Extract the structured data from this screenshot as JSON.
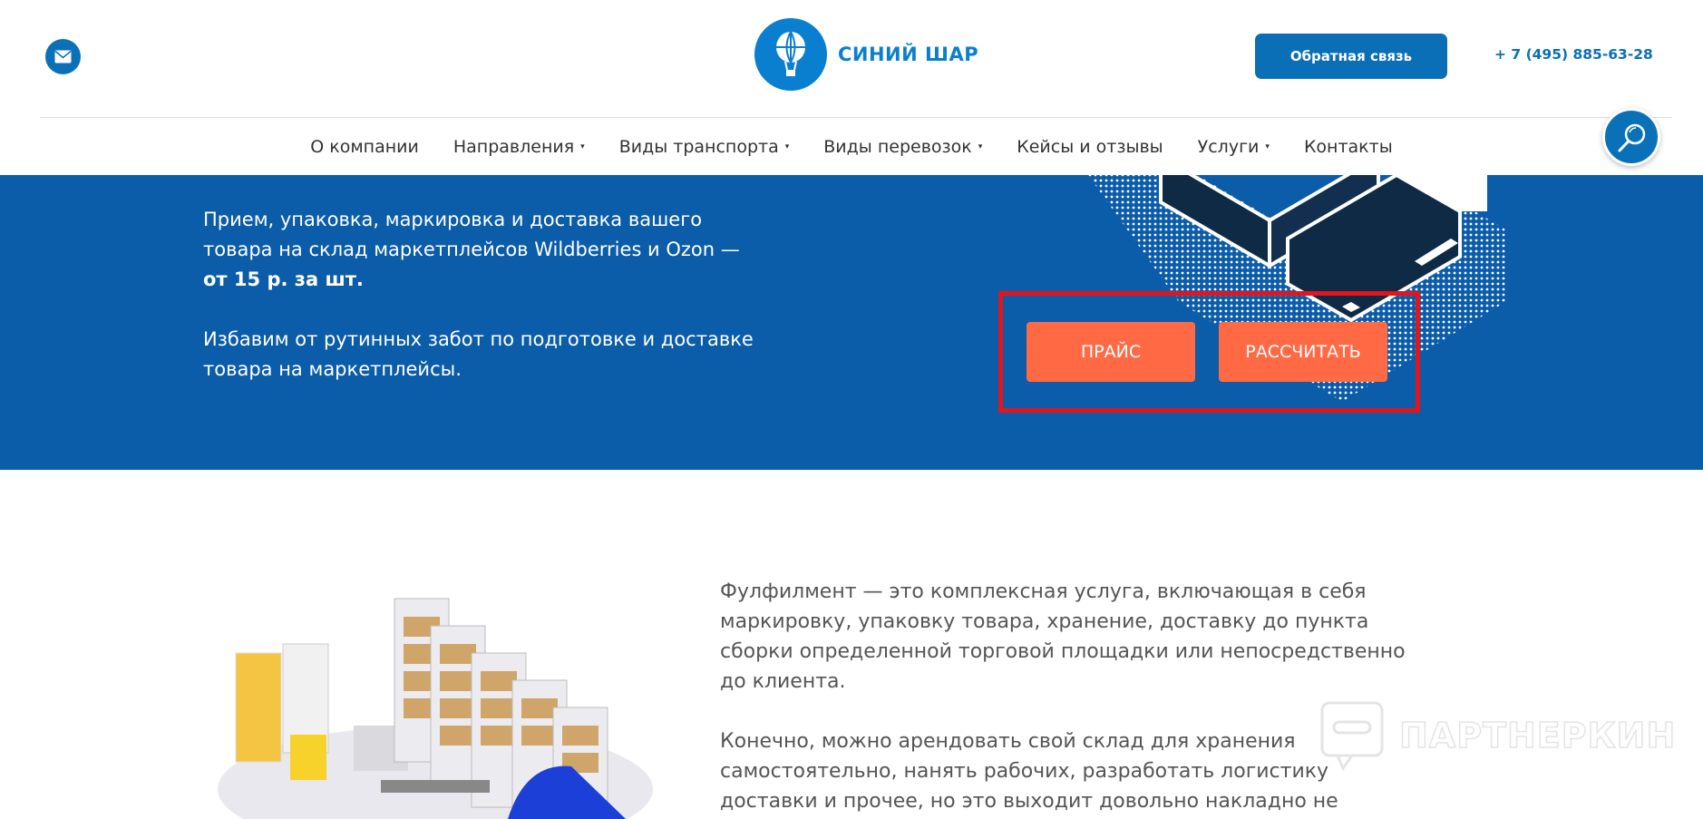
{
  "header": {
    "logo_text": "СИНИЙ ШАР",
    "callback_label": "Обратная связь",
    "phone": "+ 7 (495) 885-63-28"
  },
  "nav": {
    "items": [
      {
        "label": "О компании",
        "has_dropdown": false
      },
      {
        "label": "Направления",
        "has_dropdown": true
      },
      {
        "label": "Виды транспорта",
        "has_dropdown": true
      },
      {
        "label": "Виды перевозок",
        "has_dropdown": true
      },
      {
        "label": "Кейсы и отзывы",
        "has_dropdown": false
      },
      {
        "label": "Услуги",
        "has_dropdown": true
      },
      {
        "label": "Контакты",
        "has_dropdown": false
      }
    ],
    "caret": "▾"
  },
  "hero": {
    "line1": "Прием, упаковка, маркировка и доставка вашего товара на склад маркетплейсов Wildberries и Ozon —",
    "line1_bold": "от 15 р. за шт.",
    "line2": "Избавим от рутинных забот по подготовке и доставке товара на маркетплейсы.",
    "price_button": "ПРАЙС",
    "calc_button": "РАССЧИТАТЬ"
  },
  "content": {
    "paragraph1": "Фулфилмент — это комплексная услуга, включающая в себя маркировку, упаковку товара, хранение, доставку до пункта сборки определенной торговой площадки или непосредственно до клиента.",
    "paragraph2": "Конечно, можно арендовать свой склад для хранения самостоятельно, нанять рабочих, разработать логистику доставки и прочее, но это выходит довольно накладно не"
  },
  "watermark": {
    "text": "ПАРТНЕРКИН"
  },
  "icons": {
    "mail": "mail-icon",
    "search": "search-icon",
    "logo": "hot-air-balloon-icon"
  },
  "colors": {
    "brand_blue": "#0a71b8",
    "hero_blue": "#0b5ca9",
    "accent_orange": "#ff6a45",
    "highlight_red": "#e3141c"
  }
}
